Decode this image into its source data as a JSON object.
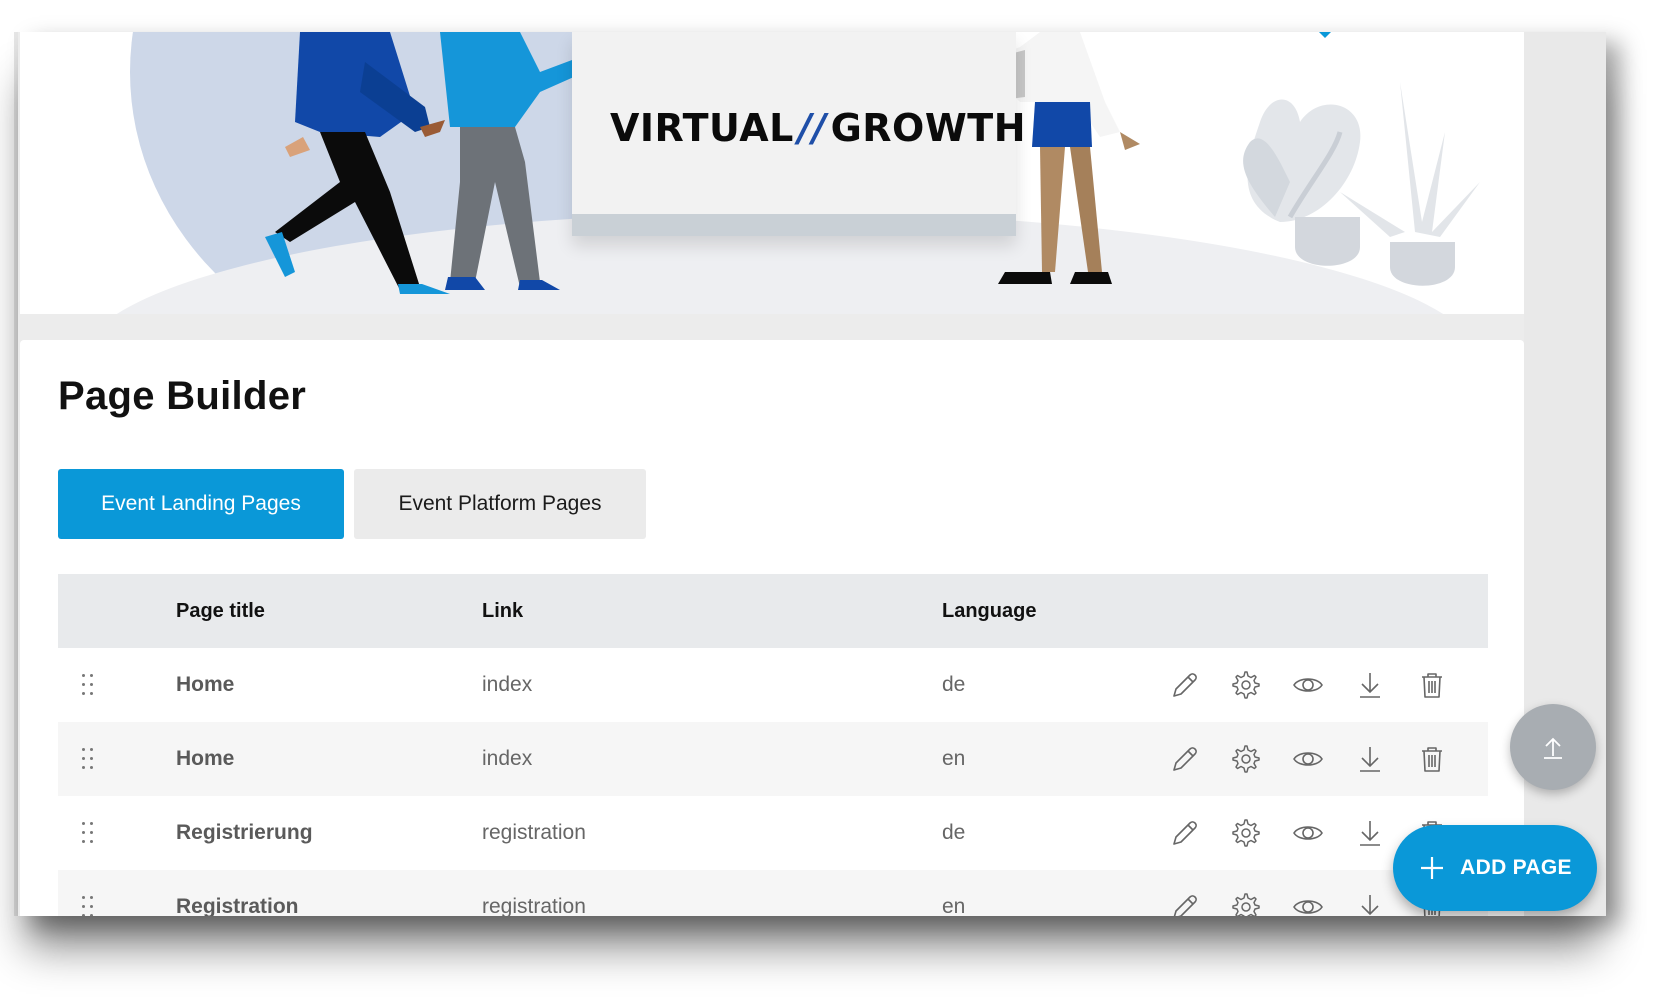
{
  "hero": {
    "title_left": "VIRTUAL",
    "title_sep": "//",
    "title_right": "GROWTH"
  },
  "page": {
    "title": "Page Builder"
  },
  "tabs": [
    {
      "label": "Event Landing Pages",
      "active": true
    },
    {
      "label": "Event Platform Pages",
      "active": false
    }
  ],
  "table": {
    "columns": [
      "Page title",
      "Link",
      "Language"
    ],
    "rows": [
      {
        "title": "Home",
        "link": "index",
        "language": "de"
      },
      {
        "title": "Home",
        "link": "index",
        "language": "en"
      },
      {
        "title": "Registrierung",
        "link": "registration",
        "language": "de"
      },
      {
        "title": "Registration",
        "link": "registration",
        "language": "en"
      }
    ],
    "row_actions": [
      "pencil-icon",
      "gear-icon",
      "eye-icon",
      "download-icon",
      "trash-icon"
    ]
  },
  "fab": {
    "scroll_top_icon": "upload-arrow-icon",
    "add_label": "ADD PAGE",
    "add_icon": "plus-icon"
  },
  "colors": {
    "accent": "#0a98d8",
    "header_bg": "#e8eaec",
    "row_alt": "#f6f6f6",
    "fab_gray": "#a8adb2"
  }
}
